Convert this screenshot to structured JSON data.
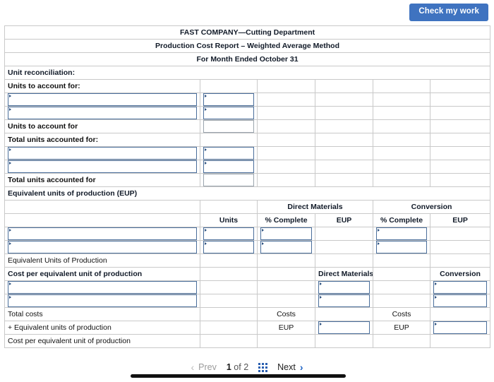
{
  "toolbar": {
    "check_work_label": "Check my work"
  },
  "report": {
    "title_line1": "FAST COMPANY—Cutting Department",
    "title_line2": "Production Cost Report – Weighted Average Method",
    "title_line3": "For Month Ended October 31",
    "section_unit_reconciliation": "Unit reconciliation:",
    "units_to_account_for_header": "Units to account for:",
    "units_to_account_for_total": "Units to account for",
    "total_units_accounted_for_header": "Total units accounted for:",
    "total_units_accounted_for_total": "Total units accounted for",
    "section_eup": "Equivalent units of production (EUP)",
    "col_units": "Units",
    "col_direct_materials": "Direct Materials",
    "col_conversion": "Conversion",
    "col_pct_complete": "% Complete",
    "col_eup": "EUP",
    "eup_total_label": "Equivalent Units of Production",
    "section_cost_per_eup": "Cost per equivalent unit of production",
    "cost_dm_header": "Direct Materials",
    "cost_conv_header": "Conversion",
    "total_costs_label": "Total costs",
    "total_costs_dm": "Costs",
    "total_costs_conv": "Costs",
    "divide_eup_label": "+ Equivalent units of production",
    "divide_eup_dm": "EUP",
    "divide_eup_conv": "EUP",
    "cost_per_eup_label": "Cost per equivalent unit of production"
  },
  "pagination": {
    "prev_label": "Prev",
    "next_label": "Next",
    "current_page": "1",
    "of_label": "of",
    "total_pages": "2",
    "prev_icon": "chevron-left-icon",
    "next_icon": "chevron-right-icon",
    "grid_icon": "grid-view-icon"
  },
  "colors": {
    "header_blue": "#7aabe3",
    "answer_yellow": "#ffffaa",
    "button_blue": "#3f73c0",
    "input_border": "#4a6e9b"
  }
}
